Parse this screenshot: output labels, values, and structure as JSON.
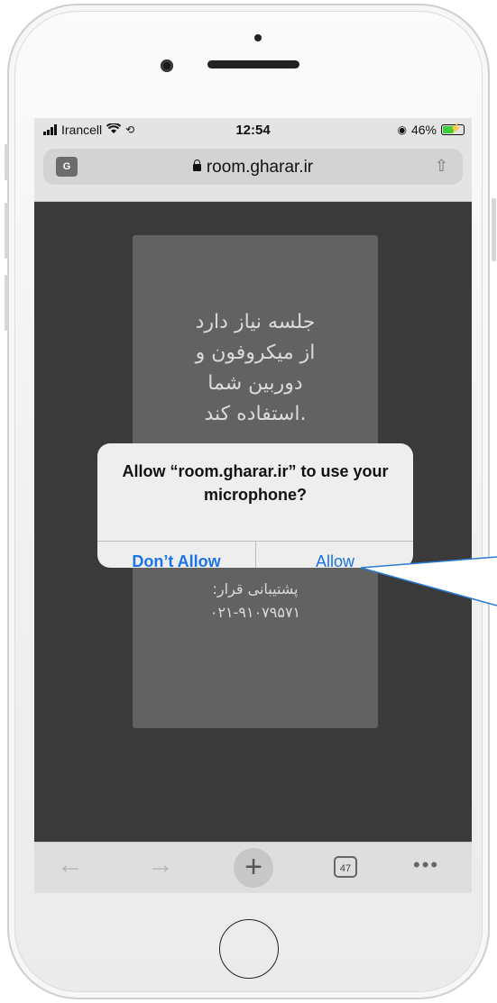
{
  "status_bar": {
    "carrier": "Irancell",
    "time": "12:54",
    "battery": "46%"
  },
  "browser": {
    "translate_icon": "G",
    "url": "room.gharar.ir",
    "share_icon": "share-icon"
  },
  "page": {
    "message_lines": [
      "جلسه نیاز دارد",
      "از میکروفون و",
      "دوربین شما",
      ".استفاده کند"
    ],
    "support_label": "پشتیبانی قرار:",
    "support_phone": "۰۲۱-۹۱۰۷۹۵۷۱"
  },
  "dialog": {
    "title": "Allow “room.gharar.ir” to use your microphone?",
    "deny_label": "Don’t Allow",
    "allow_label": "Allow"
  },
  "toolbar": {
    "back": "←",
    "forward": "→",
    "new_tab": "+",
    "tab_count": "47",
    "more": "•••"
  },
  "colors": {
    "dialog_button": "#1a73e8",
    "callout_stroke": "#2b7bd4",
    "overlay": "#3a3a3a"
  }
}
